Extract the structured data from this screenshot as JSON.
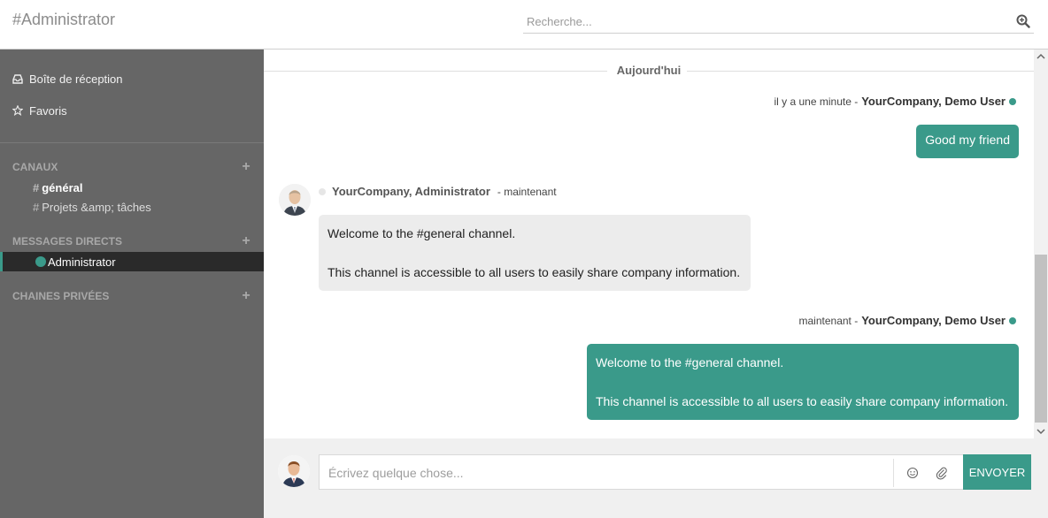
{
  "header": {
    "title": "#Administrator",
    "search_placeholder": "Recherche..."
  },
  "sidebar": {
    "inbox_label": "Boîte de réception",
    "favorites_label": "Favoris",
    "channels_heading": "CANAUX",
    "channels": [
      {
        "label": "général",
        "active": true
      },
      {
        "label": "Projets &amp; tâches",
        "active": false
      }
    ],
    "direct_heading": "MESSAGES DIRECTS",
    "direct_messages": [
      {
        "label": "Administrator",
        "online": true
      }
    ],
    "private_heading": "CHAINES PRIVÉES",
    "add_symbol": "+",
    "hash_symbol": "#"
  },
  "thread": {
    "day_separator": "Aujourd'hui",
    "messages": [
      {
        "time": "il y a une minute - ",
        "author": "YourCompany, Demo User",
        "lines": [
          "Good my friend"
        ],
        "outgoing": true
      },
      {
        "time": "- maintenant",
        "author": "YourCompany, Administrator",
        "lines": [
          "Welcome to the #general channel.",
          "This channel is accessible to all users to easily share company information."
        ],
        "outgoing": false
      },
      {
        "time": "maintenant - ",
        "author": "YourCompany, Demo User",
        "lines": [
          "Welcome to the #general channel.",
          "This channel is accessible to all users to easily share company information."
        ],
        "outgoing": true
      }
    ]
  },
  "composer": {
    "placeholder": "Écrivez quelque chose...",
    "send_label": "ENVOYER"
  },
  "colors": {
    "accent": "#3a9a8a",
    "sidebar_bg": "#666666",
    "active_row_bg": "#2a2a2a",
    "incoming_bubble": "#ececec"
  },
  "icons": [
    "search-icon",
    "inbox-icon",
    "star-icon",
    "plus-icon",
    "status-dot-icon",
    "smiley-icon",
    "paperclip-icon",
    "scroll-arrow-icon"
  ]
}
